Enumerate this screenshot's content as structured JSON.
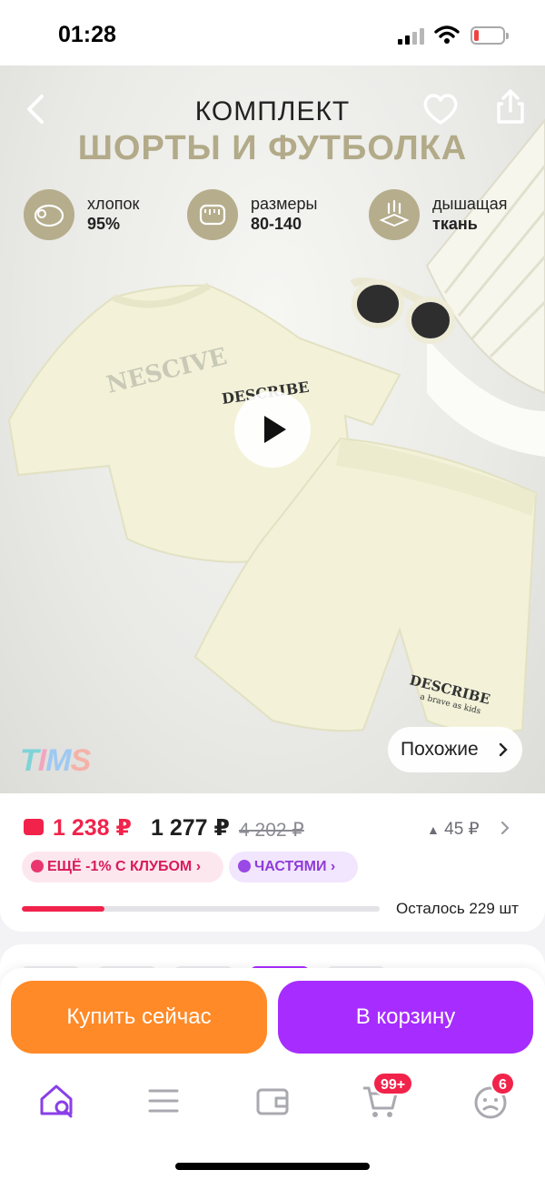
{
  "status_bar": {
    "time": "01:28",
    "battery_level": 0.15
  },
  "hero": {
    "title_line1": "КОМПЛЕКТ",
    "title_line2": "ШОРТЫ И ФУТБОЛКА",
    "features": [
      {
        "line1": "хлопок",
        "line2": "95%",
        "icon": "sheep-icon"
      },
      {
        "line1": "размеры",
        "line2": "80-140",
        "icon": "measuring-tape-icon"
      },
      {
        "line1": "дышащая",
        "line2": "ткань",
        "icon": "airflow-icon"
      }
    ],
    "print_text": "DESCRIBE",
    "print_subtext": "a brave as kids",
    "similar_label": "Похожие",
    "brand_logo": "TIMS"
  },
  "price": {
    "club_price": "1 238 ₽",
    "price": "1 277 ₽",
    "old_price": "4 202 ₽",
    "delta": "45 ₽",
    "club_pill": "ЕЩЁ -1% С КЛУБОМ",
    "installments_pill": "ЧАСТЯМИ",
    "stock_label": "Осталось 229 шт",
    "stock_fraction": 0.23
  },
  "actions": {
    "buy_now": "Купить сейчас",
    "add_to_cart": "В корзину"
  },
  "tabbar": {
    "items": [
      {
        "name": "home",
        "icon": "home-search-icon"
      },
      {
        "name": "catalog",
        "icon": "menu-icon"
      },
      {
        "name": "wallet",
        "icon": "wallet-icon"
      },
      {
        "name": "cart",
        "icon": "cart-icon",
        "badge": "99+"
      },
      {
        "name": "profile",
        "icon": "profile-icon",
        "badge": "6"
      }
    ]
  },
  "colors": {
    "accent_red": "#f1234b",
    "buy_orange": "#ff8a27",
    "cart_purple": "#a72cff",
    "hero_olive": "#b5ad8c"
  }
}
